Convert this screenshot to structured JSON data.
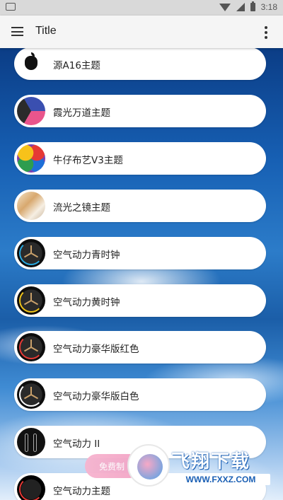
{
  "status_bar": {
    "time": "3:18"
  },
  "app_bar": {
    "title": "Title"
  },
  "list": {
    "items": [
      {
        "label": "源A16主题",
        "thumb": "apple-logo"
      },
      {
        "label": "霞光万道主题",
        "thumb": "cube"
      },
      {
        "label": "牛仔布艺V3主题",
        "thumb": "color-dots"
      },
      {
        "label": "流光之镜主题",
        "thumb": "glass"
      },
      {
        "label": "空气动力青时钟",
        "thumb": "clock-blue"
      },
      {
        "label": "空气动力黄时钟",
        "thumb": "clock-yellow"
      },
      {
        "label": "空气动力豪华版红色",
        "thumb": "clock-red"
      },
      {
        "label": "空气动力豪华版白色",
        "thumb": "clock-white"
      },
      {
        "label": "空气动力 II",
        "thumb": "bars"
      },
      {
        "label": "空气动力主题",
        "thumb": "clock-base"
      }
    ]
  },
  "overlay": {
    "free_badge": "免费制",
    "watermark_text": "飞翔下载",
    "watermark_url": "WWW.FXXZ.COM"
  }
}
